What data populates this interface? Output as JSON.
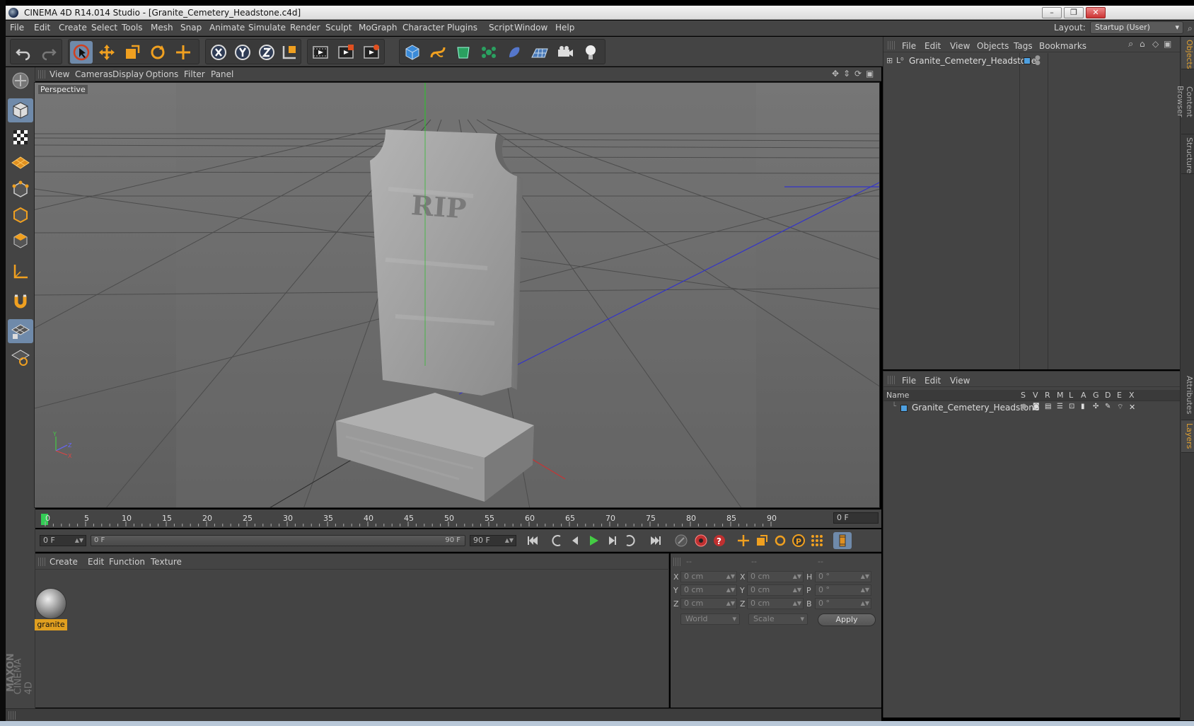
{
  "window": {
    "title": "CINEMA 4D R14.014 Studio - [Granite_Cemetery_Headstone.c4d]",
    "minimize": "–",
    "restore": "❐",
    "close": "✕"
  },
  "menubar": {
    "items": [
      "File",
      "Edit",
      "Create",
      "Select",
      "Tools",
      "Mesh",
      "Snap",
      "Animate",
      "Simulate",
      "Render",
      "Sculpt",
      "MoGraph",
      "Character",
      "Plugins",
      "Script",
      "Window",
      "Help"
    ],
    "layout_label": "Layout:",
    "layout_value": "Startup (User)"
  },
  "viewport": {
    "menu": [
      "View",
      "Cameras",
      "Display",
      "Options",
      "Filter",
      "Panel"
    ],
    "label": "Perspective",
    "engraving": "RIP"
  },
  "timeline": {
    "ticks": [
      "0",
      "5",
      "10",
      "15",
      "20",
      "25",
      "30",
      "35",
      "40",
      "45",
      "50",
      "55",
      "60",
      "65",
      "70",
      "75",
      "80",
      "85",
      "90"
    ],
    "current_frame": "0 F",
    "start_frame": "0 F",
    "range_start": "0 F",
    "range_end": "90 F",
    "end_frame": "90 F"
  },
  "material_panel": {
    "menu": [
      "Create",
      "Edit",
      "Function",
      "Texture"
    ],
    "material_name": "granite"
  },
  "coords": {
    "headers": [
      "--",
      "--",
      "--"
    ],
    "rows": [
      {
        "lbl1": "X",
        "v1": "0 cm",
        "lbl2": "X",
        "v2": "0 cm",
        "lbl3": "H",
        "v3": "0 °"
      },
      {
        "lbl1": "Y",
        "v1": "0 cm",
        "lbl2": "Y",
        "v2": "0 cm",
        "lbl3": "P",
        "v3": "0 °"
      },
      {
        "lbl1": "Z",
        "v1": "0 cm",
        "lbl2": "Z",
        "v2": "0 cm",
        "lbl3": "B",
        "v3": "0 °"
      }
    ],
    "space": "World",
    "mode": "Scale",
    "apply": "Apply"
  },
  "object_manager": {
    "menu": [
      "File",
      "Edit",
      "View",
      "Objects",
      "Tags",
      "Bookmarks"
    ],
    "object_name": "Granite_Cemetery_Headstone"
  },
  "layer_manager": {
    "menu": [
      "File",
      "Edit",
      "View"
    ],
    "columns": [
      "Name",
      "S",
      "V",
      "R",
      "M",
      "L",
      "A",
      "G",
      "D",
      "E",
      "X"
    ],
    "layer_name": "Granite_Cemetery_Headstone"
  },
  "right_tabs": [
    "Objects",
    "Content Browser",
    "Structure",
    "Attributes",
    "Layers"
  ],
  "brand": {
    "maxon": "MAXON",
    "c4d": "CINEMA 4D"
  },
  "colors": {
    "accent": "#e09f20",
    "bg": "#444444",
    "viewport": "#6a6a6a"
  }
}
